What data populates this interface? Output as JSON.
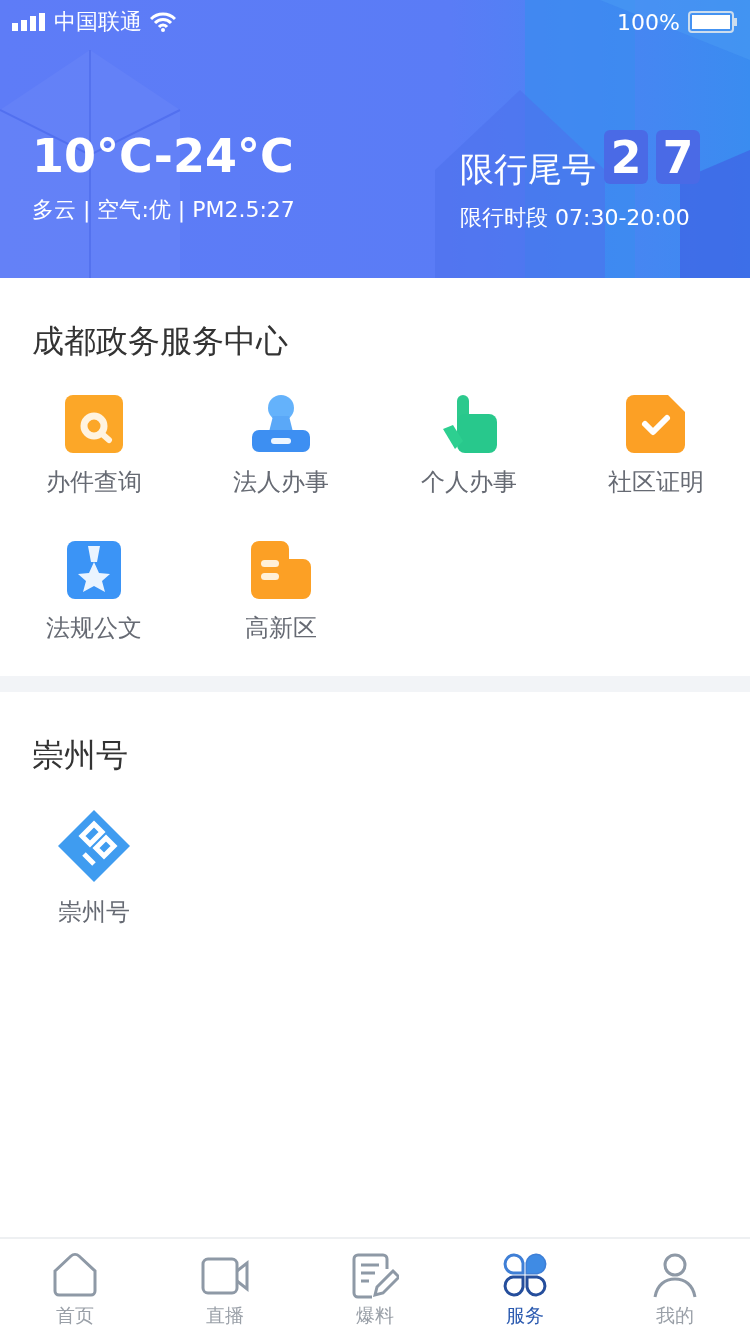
{
  "status_bar": {
    "carrier": "中国联通",
    "battery": "100%"
  },
  "header": {
    "temperature": "10°C-24°C",
    "weather": "多云 | 空气:优 | PM2.5:27",
    "restriction_label": "限行尾号",
    "restriction_digits": [
      "2",
      "7"
    ],
    "restriction_time": "限行时段 07:30-20:00"
  },
  "sections": [
    {
      "title": "成都政务服务中心",
      "items": [
        {
          "label": "办件查询",
          "kind": "search"
        },
        {
          "label": "法人办事",
          "kind": "stamp"
        },
        {
          "label": "个人办事",
          "kind": "hand"
        },
        {
          "label": "社区证明",
          "kind": "check"
        },
        {
          "label": "法规公文",
          "kind": "star"
        },
        {
          "label": "高新区",
          "kind": "folder"
        }
      ]
    },
    {
      "title": "崇州号",
      "items": [
        {
          "label": "崇州号",
          "kind": "logo"
        }
      ]
    }
  ],
  "tab_bar": [
    {
      "label": "首页",
      "kind": "home",
      "selected": false
    },
    {
      "label": "直播",
      "kind": "video",
      "selected": false
    },
    {
      "label": "爆料",
      "kind": "edit",
      "selected": false
    },
    {
      "label": "服务",
      "kind": "service",
      "selected": true
    },
    {
      "label": "我的",
      "kind": "user",
      "selected": false
    }
  ]
}
